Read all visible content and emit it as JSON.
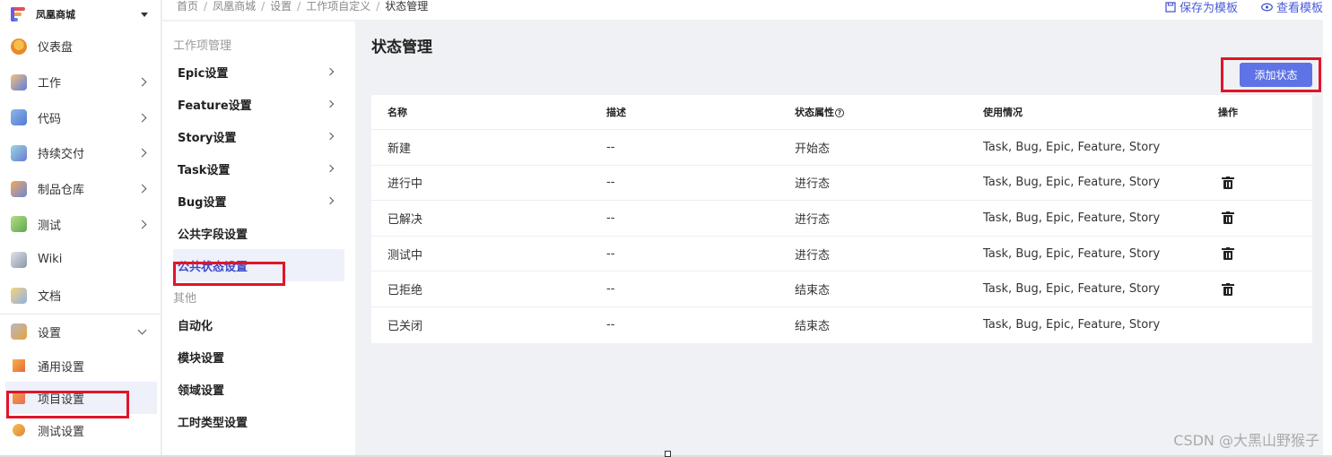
{
  "sidebar": {
    "project_name": "凤凰商城",
    "items": [
      {
        "label": "仪表盘",
        "icon": "dashboard-icon",
        "has_children": false
      },
      {
        "label": "工作",
        "icon": "work-icon",
        "has_children": true
      },
      {
        "label": "代码",
        "icon": "code-icon",
        "has_children": true
      },
      {
        "label": "持续交付",
        "icon": "delivery-icon",
        "has_children": true
      },
      {
        "label": "制品仓库",
        "icon": "artifact-icon",
        "has_children": true
      },
      {
        "label": "测试",
        "icon": "test-icon",
        "has_children": true
      },
      {
        "label": "Wiki",
        "icon": "wiki-icon",
        "has_children": false
      },
      {
        "label": "文档",
        "icon": "docs-icon",
        "has_children": false
      }
    ],
    "settings": {
      "label": "设置",
      "icon": "settings-icon",
      "children": [
        {
          "label": "通用设置",
          "icon": "general-settings-icon"
        },
        {
          "label": "项目设置",
          "icon": "project-settings-icon",
          "active": true
        },
        {
          "label": "测试设置",
          "icon": "test-settings-icon"
        }
      ]
    }
  },
  "breadcrumb": [
    "首页",
    "凤凰商城",
    "设置",
    "工作项自定义",
    "状态管理"
  ],
  "top_actions": {
    "save_template": "保存为模板",
    "view_template": "查看模板"
  },
  "midpanel": {
    "group1_title": "工作项管理",
    "group1_items": [
      {
        "label": "Epic设置",
        "has_children": true
      },
      {
        "label": "Feature设置",
        "has_children": true
      },
      {
        "label": "Story设置",
        "has_children": true
      },
      {
        "label": "Task设置",
        "has_children": true
      },
      {
        "label": "Bug设置",
        "has_children": true
      },
      {
        "label": "公共字段设置",
        "has_children": false
      },
      {
        "label": "公共状态设置",
        "has_children": false,
        "active": true
      }
    ],
    "group2_title": "其他",
    "group2_items": [
      {
        "label": "自动化"
      },
      {
        "label": "模块设置"
      },
      {
        "label": "领域设置"
      },
      {
        "label": "工时类型设置"
      }
    ]
  },
  "main": {
    "title": "状态管理",
    "add_button": "添加状态",
    "table": {
      "headers": {
        "name": "名称",
        "desc": "描述",
        "attr": "状态属性",
        "usage": "使用情况",
        "ops": "操作"
      },
      "help_glyph": "?",
      "rows": [
        {
          "name": "新建",
          "desc": "--",
          "attr": "开始态",
          "usage": "Task, Bug, Epic, Feature, Story",
          "deletable": false
        },
        {
          "name": "进行中",
          "desc": "--",
          "attr": "进行态",
          "usage": "Task, Bug, Epic, Feature, Story",
          "deletable": true
        },
        {
          "name": "已解决",
          "desc": "--",
          "attr": "进行态",
          "usage": "Task, Bug, Epic, Feature, Story",
          "deletable": true
        },
        {
          "name": "测试中",
          "desc": "--",
          "attr": "进行态",
          "usage": "Task, Bug, Epic, Feature, Story",
          "deletable": true
        },
        {
          "name": "已拒绝",
          "desc": "--",
          "attr": "结束态",
          "usage": "Task, Bug, Epic, Feature, Story",
          "deletable": true
        },
        {
          "name": "已关闭",
          "desc": "--",
          "attr": "结束态",
          "usage": "Task, Bug, Epic, Feature, Story",
          "deletable": false
        }
      ]
    }
  },
  "watermark": "CSDN @大黑山野猴子",
  "colors": {
    "accent": "#5d73e6",
    "link": "#4a5bd6",
    "highlight_box": "#e0152a",
    "active_bg": "#eef0fa"
  }
}
